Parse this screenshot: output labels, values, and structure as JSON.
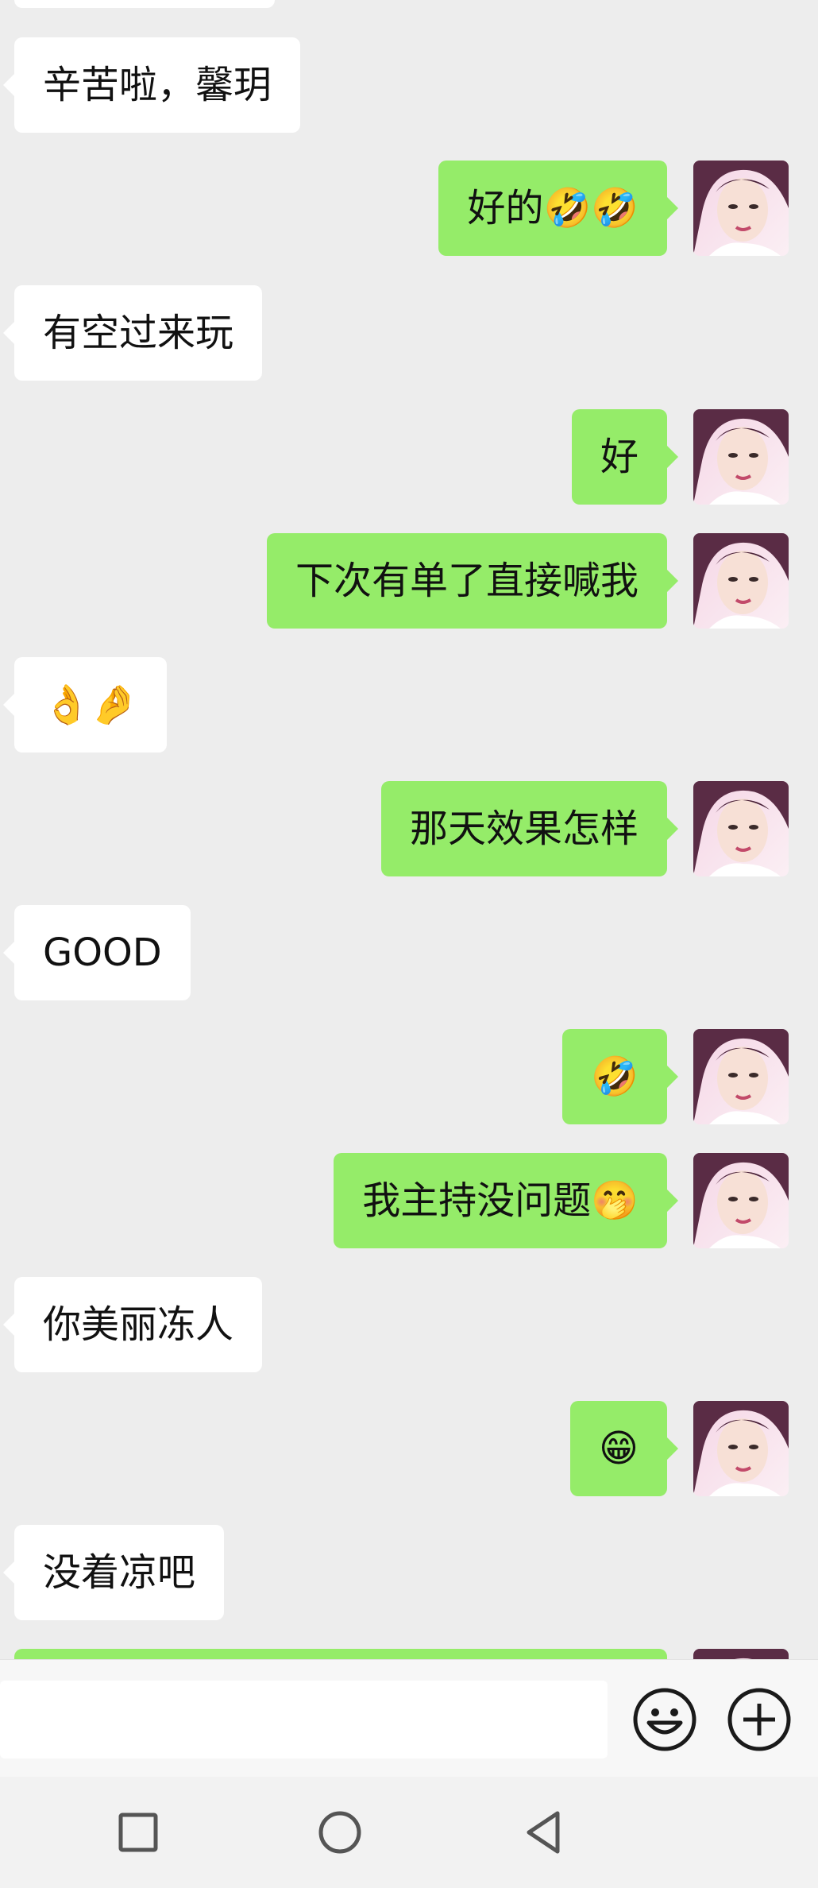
{
  "messages": [
    {
      "side": "left",
      "text": "辛苦啦，馨玥"
    },
    {
      "side": "right",
      "text": "好的🤣🤣"
    },
    {
      "side": "left",
      "text": "有空过来玩"
    },
    {
      "side": "right",
      "text": "好"
    },
    {
      "side": "right",
      "text": "下次有单了直接喊我"
    },
    {
      "side": "left",
      "text": "👌🤌"
    },
    {
      "side": "right",
      "text": "那天效果怎样"
    },
    {
      "side": "left",
      "text": "GOOD"
    },
    {
      "side": "right",
      "text": "🤣"
    },
    {
      "side": "right",
      "text": "我主持没问题🤭"
    },
    {
      "side": "left",
      "text": "你美丽冻人"
    },
    {
      "side": "right",
      "text": "😁"
    },
    {
      "side": "left",
      "text": "没着凉吧"
    }
  ],
  "input_bar": {
    "message_value": "",
    "emoji_icon": "smiley-face-icon",
    "more_icon": "plus-circle-icon"
  },
  "nav_bar": {
    "recents_icon": "square-icon",
    "home_icon": "circle-icon",
    "back_icon": "triangle-back-icon"
  },
  "colors": {
    "chat_background": "#ededed",
    "sent_bubble": "#95ec69",
    "received_bubble": "#ffffff"
  }
}
